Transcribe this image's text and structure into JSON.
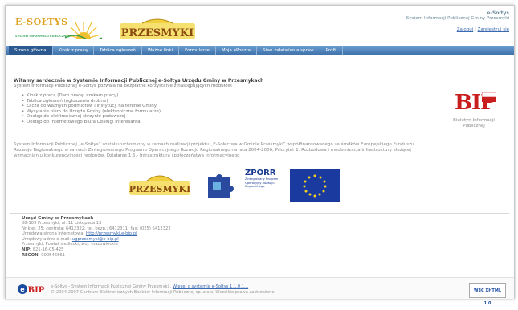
{
  "header": {
    "logo_text": "E-SOŁTYS",
    "logo_sub": "SYSTEM INFORMACJI PUBLICZNEJ",
    "town_logo_text": "PRZESMYKI",
    "brand": "e-Sołtys",
    "system": "System Informacji Publicznej Gminy Przesmyki",
    "login_label": "Zaloguj",
    "register_label": "Zarejestruj się",
    "separator": "|"
  },
  "nav": {
    "items": [
      {
        "label": "Strona główna"
      },
      {
        "label": "Kiosk z pracą"
      },
      {
        "label": "Tablica ogłoszeń"
      },
      {
        "label": "Ważne linki"
      },
      {
        "label": "Formularze"
      },
      {
        "label": "Moja ePoczta"
      },
      {
        "label": "Stan załatwiania spraw"
      },
      {
        "label": "Profil"
      }
    ]
  },
  "welcome": {
    "heading": "Witamy serdecznie w Systemie Informacji Publicznej e-Sołtys Urzędu Gminy w Przesmykach",
    "intro": "System Informacji Publicznej e-Sołtys pozwala na bezpłatne korzystanie z następujących modułów:",
    "modules": [
      "Kiosk z pracą (Dam pracę, szukam pracy)",
      "Tablica ogłoszeń (ogłoszenia drobne)",
      "Łącza do ważnych podmiotów i instytucji na terenie Gminy",
      "Wysyłanie pism do Urzędu Gminy (elektroniczne formularze)",
      "Dostęp do elektronicznej skrzynki podawczej",
      "Dostęp do Internetowego Biura Obsługi Interesanta"
    ],
    "description": "System Informacji Publicznej „e-Sołtys” został uruchomiony w ramach realizacji projektu „E-Sołectwa w Gminie Przesmyki” współfinansowanego ze środków Europejskiego Funduszu Rozwoju Regionalnego w ramach Zintegrowanego Programu Operacyjnego Rozwoju Regionalnego na lata 2004-2006; Priorytet 1. Rozbudowa i modernizacja infrastruktury służącej wzmacnianiu konkurencyjności regionów, Działanie 1.5.- Infrastruktura społeczeństwa informacyjnego"
  },
  "bip": {
    "logo_text": "BIP",
    "caption_1": "Biuletyn Informacji",
    "caption_2": "Publicznej"
  },
  "sponsors": {
    "przesmyki": "PRZESMYKI",
    "zporr_title": "ZPORR",
    "zporr_sub": "Zintegrowany Program Operacyjny Rozwoju Regionalnego"
  },
  "address": {
    "name": "Urząd Gminy w Przesmykach",
    "lines": [
      "08-109 Przesmyki, ul. 11 Listopada 13",
      "Nr kier. 25; centrala: 6412322; tel. bezp.: 6412311; fax: (025) 6412322",
      "Urzędowa strona internetowa: ",
      "Urzędowy adres e-mail: ",
      "Przesmyki, Powiat siedlecki, woj. mazowieckie"
    ],
    "website": "http://przesmyki.e-bip.pl",
    "email": "ugprzesmyki@e-bip.pl",
    "nip_label": "NIP:",
    "nip": "821-16-05-425",
    "regon_label": "REGON:",
    "regon": "000546561"
  },
  "footer": {
    "line1": "e-Sołtys - System Informacji Publicznej Gminy Przesmyki .",
    "more_link": "Więcej o systemie e-Sołtys 1.1.0.1...",
    "line2": "© 2004-2007 Centrum Elektronicznych Banków Informacji Publicznej sp. z o.o. Wszelkie prawa zastrzeżone.",
    "badge": "W3C XHTML 1.0"
  },
  "colors": {
    "nav_bg": "#3c6ea8",
    "accent": "#c81e1e",
    "link": "#3a6ab0"
  }
}
